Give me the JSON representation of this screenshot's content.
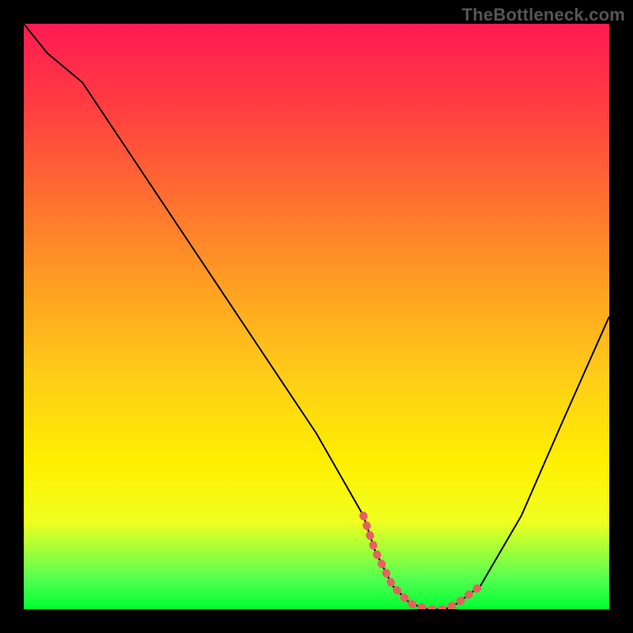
{
  "watermark": "TheBottleneck.com",
  "chart_data": {
    "type": "line",
    "title": "",
    "xlabel": "",
    "ylabel": "",
    "ylim": [
      0,
      100
    ],
    "series": [
      {
        "name": "curve",
        "x": [
          0,
          4,
          10,
          20,
          30,
          40,
          50,
          58,
          60,
          63,
          66,
          69,
          72,
          74,
          78,
          85,
          92,
          100
        ],
        "values": [
          100,
          95,
          90,
          75,
          60,
          45,
          30,
          16,
          10,
          4,
          1,
          0,
          0,
          1,
          4,
          16,
          32,
          50
        ]
      }
    ],
    "flat_zone": {
      "x_start": 58,
      "x_end": 78,
      "color": "#e86060"
    },
    "gradient_stops": [
      {
        "pos": 0,
        "color": "#ff1a52"
      },
      {
        "pos": 15,
        "color": "#ff4040"
      },
      {
        "pos": 30,
        "color": "#ff7030"
      },
      {
        "pos": 45,
        "color": "#ffa022"
      },
      {
        "pos": 60,
        "color": "#ffcc18"
      },
      {
        "pos": 75,
        "color": "#fff000"
      },
      {
        "pos": 85,
        "color": "#f0ff20"
      },
      {
        "pos": 95,
        "color": "#50ff50"
      },
      {
        "pos": 100,
        "color": "#00ff30"
      }
    ]
  }
}
